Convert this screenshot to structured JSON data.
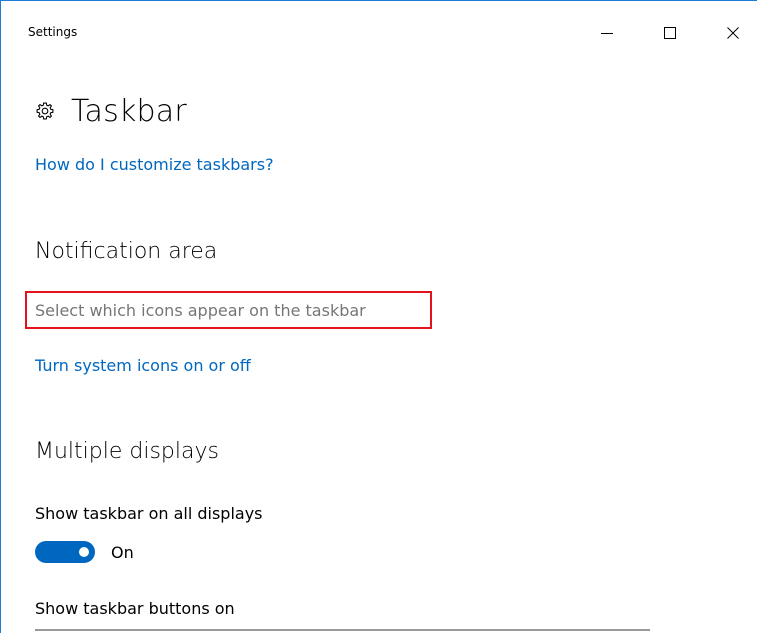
{
  "window": {
    "title": "Settings",
    "controls": {
      "minimize_icon": "minimize-icon",
      "maximize_icon": "maximize-icon",
      "close_icon": "close-icon"
    }
  },
  "page": {
    "icon": "gear-icon",
    "title": "Taskbar",
    "help_link": "How do I customize taskbars?"
  },
  "notification_area": {
    "title": "Notification area",
    "select_icons_link": "Select which icons appear on the taskbar",
    "system_icons_link": "Turn system icons on or off"
  },
  "multiple_displays": {
    "title": "Multiple displays",
    "show_all_label": "Show taskbar on all displays",
    "show_all_toggle_state": "On",
    "show_buttons_label": "Show taskbar buttons on"
  },
  "colors": {
    "accent": "#0067c0",
    "highlight_box": "#e4131b",
    "border": "#1e7cd6"
  }
}
